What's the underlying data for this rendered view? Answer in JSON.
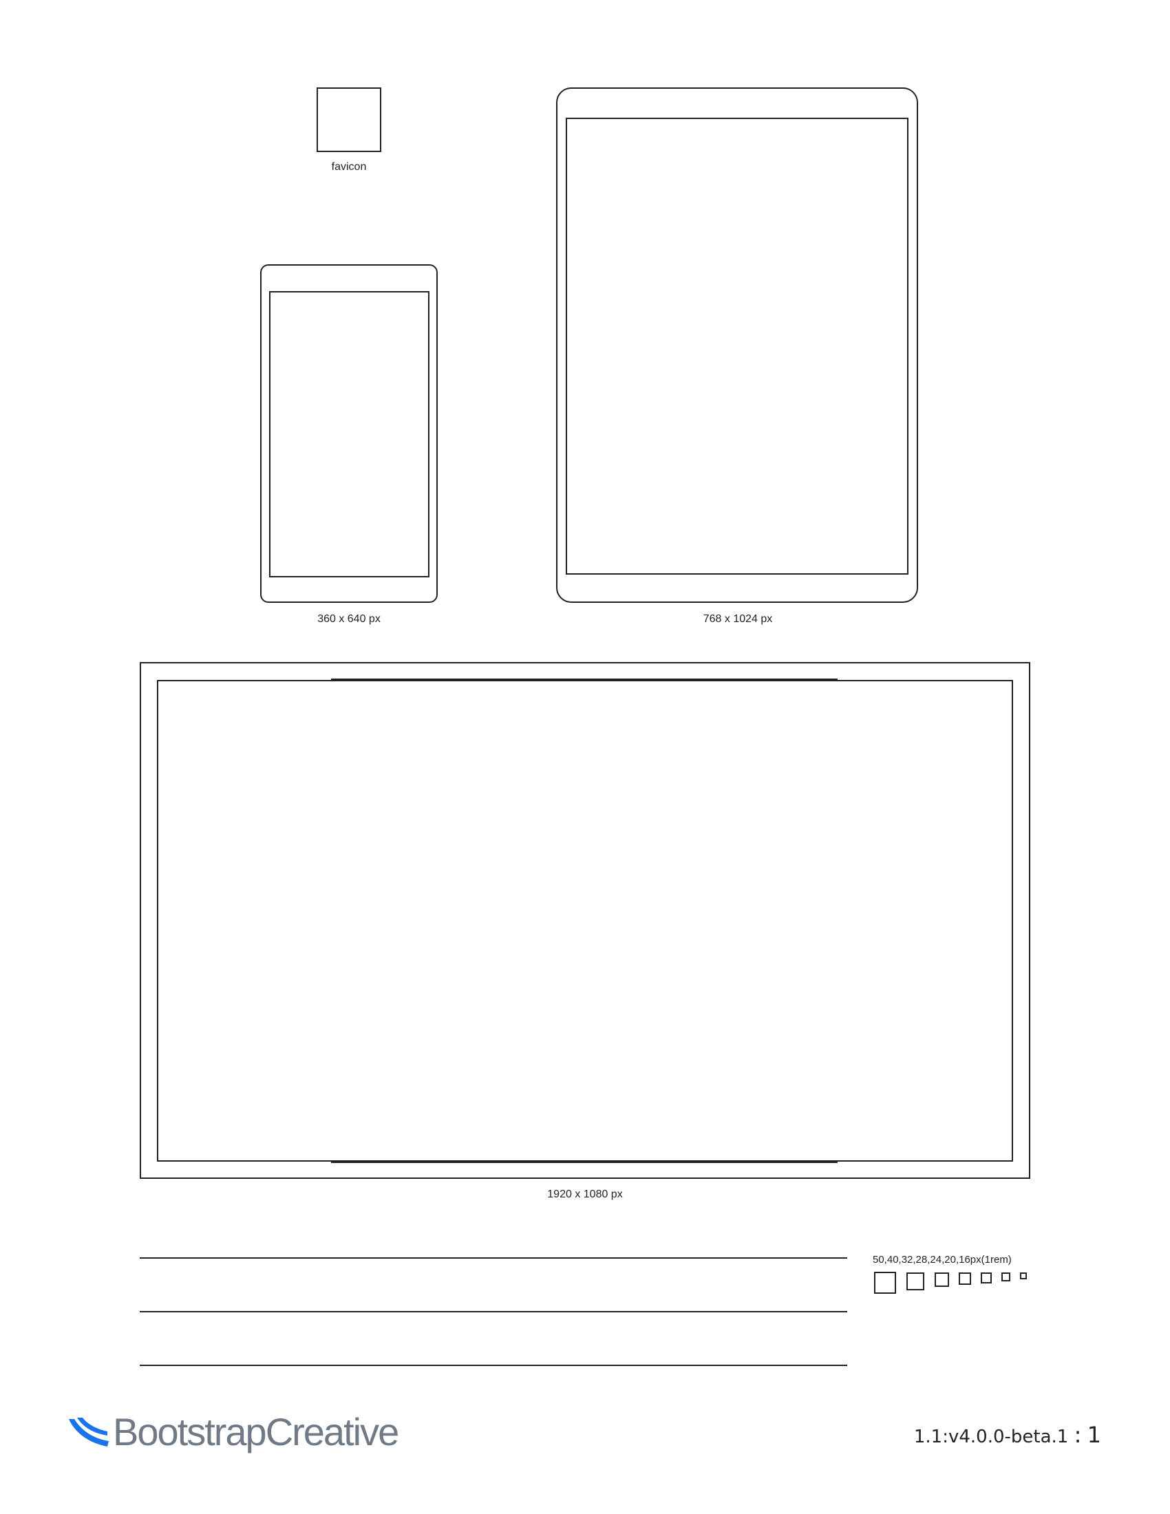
{
  "favicon": {
    "label": "favicon"
  },
  "phone": {
    "label": "360 x 640 px"
  },
  "tablet": {
    "label": "768 x 1024 px"
  },
  "desktop": {
    "label": "1920 x 1080 px"
  },
  "icon_sizes": {
    "label": "50,40,32,28,24,20,16px(1rem)"
  },
  "brand": {
    "name": "BootstrapCreative",
    "icon": "bootstrapcreative-logo-mark",
    "accent_color": "#1a73e8",
    "text_color": "#6f7a86"
  },
  "footer": {
    "version": "1.1:v4.0.0-beta.1",
    "separator": ":",
    "page_number": "1"
  }
}
